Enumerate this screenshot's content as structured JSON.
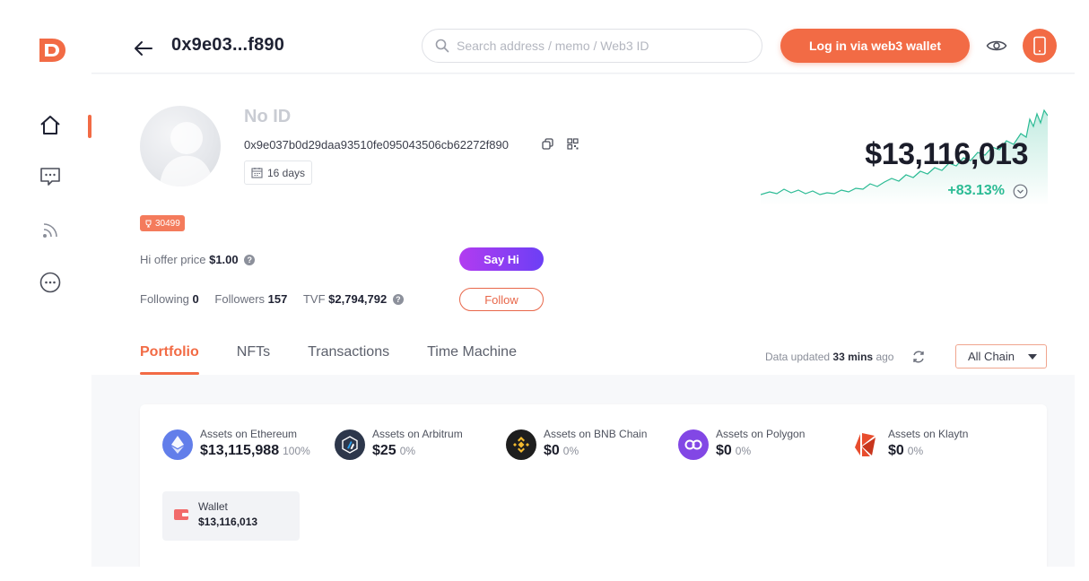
{
  "app": {
    "brand_color": "#f26b45"
  },
  "sidebar": {
    "items": [
      {
        "icon": "home-icon",
        "active": true
      },
      {
        "icon": "chat-icon",
        "active": false
      },
      {
        "icon": "feed-icon",
        "active": false
      },
      {
        "icon": "more-icon",
        "active": false
      }
    ]
  },
  "header": {
    "address_short": "0x9e03...f890",
    "search_placeholder": "Search address / memo / Web3 ID",
    "login_label": "Log in via web3 wallet"
  },
  "profile": {
    "name": "No ID",
    "address": "0x9e037b0d29daa93510fe095043506cb62272f890",
    "age": "16 days",
    "score": "30499",
    "hi_offer_label": "Hi offer price",
    "hi_offer_value": "$1.00",
    "following_label": "Following",
    "following_value": "0",
    "followers_label": "Followers",
    "followers_value": "157",
    "tvf_label": "TVF",
    "tvf_value": "$2,794,792",
    "say_hi_label": "Say Hi",
    "follow_label": "Follow",
    "balance": "$13,116,013",
    "change": "+83.13%",
    "change_color": "#2bbb94"
  },
  "tabs": [
    {
      "label": "Portfolio",
      "active": true
    },
    {
      "label": "NFTs",
      "active": false
    },
    {
      "label": "Transactions",
      "active": false
    },
    {
      "label": "Time Machine",
      "active": false
    }
  ],
  "data_updated": {
    "prefix": "Data updated",
    "value": "33 mins",
    "suffix": "ago"
  },
  "chain_filter": {
    "selected": "All Chain"
  },
  "assets": [
    {
      "label": "Assets on Ethereum",
      "value": "$13,115,988",
      "pct": "100%",
      "icon": "ethereum-icon",
      "color": "#627eea"
    },
    {
      "label": "Assets on Arbitrum",
      "value": "$25",
      "pct": "0%",
      "icon": "arbitrum-icon",
      "color": "#2d374b"
    },
    {
      "label": "Assets on BNB Chain",
      "value": "$0",
      "pct": "0%",
      "icon": "bnb-icon",
      "color": "#1e1e1e"
    },
    {
      "label": "Assets on Polygon",
      "value": "$0",
      "pct": "0%",
      "icon": "polygon-icon",
      "color": "#8247e5"
    },
    {
      "label": "Assets on Klaytn",
      "value": "$0",
      "pct": "0%",
      "icon": "klaytn-icon",
      "color": "#e84d2e"
    }
  ],
  "wallet": {
    "label": "Wallet",
    "value": "$13,116,013",
    "icon": "wallet-icon"
  }
}
